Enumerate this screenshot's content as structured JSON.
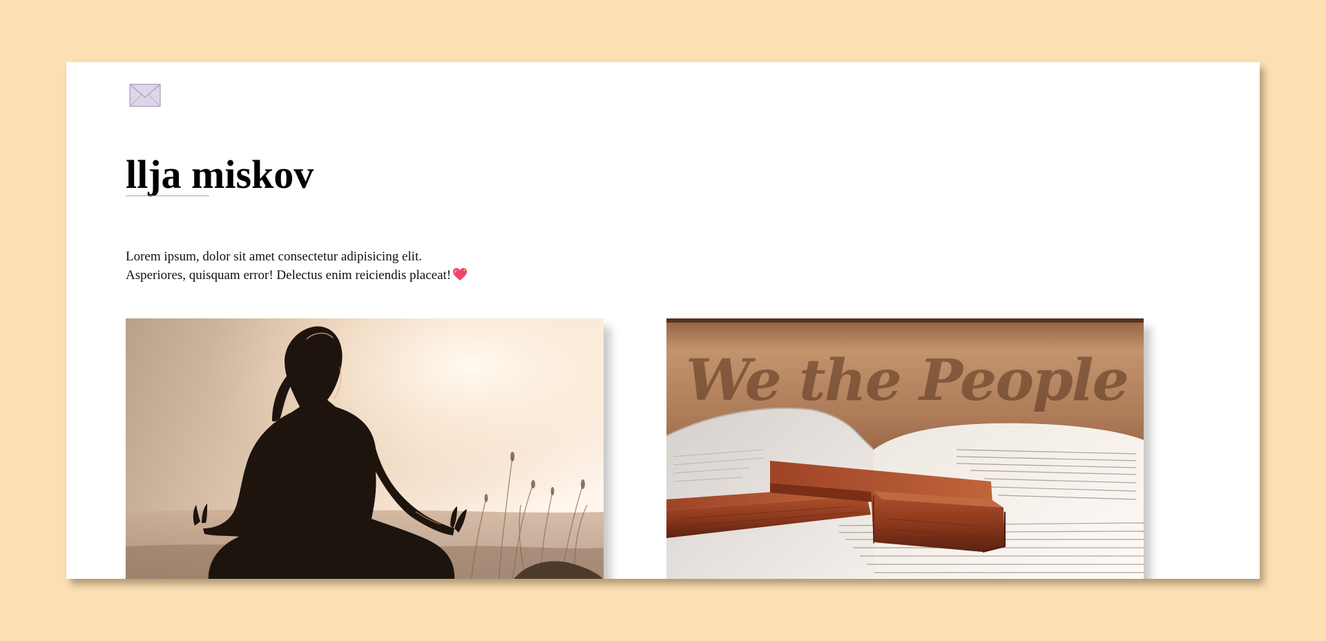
{
  "header": {
    "icon": "envelope-icon",
    "title": "llja miskov"
  },
  "intro": {
    "line1": "Lorem ipsum, dolor sit amet consectetur adipisicing elit.",
    "line2": "Asperiores, quisquam error! Delectus enim reiciendis placeat!",
    "emoji_icon": "sparkling-heart-icon"
  },
  "gallery": {
    "images": [
      {
        "name": "meditation-photo"
      },
      {
        "name": "cross-on-bible-photo",
        "overlay_text": "We the People"
      }
    ]
  },
  "colors": {
    "page_background": "#fce0b4",
    "card_background": "#ffffff",
    "heart": "#f0456b"
  }
}
